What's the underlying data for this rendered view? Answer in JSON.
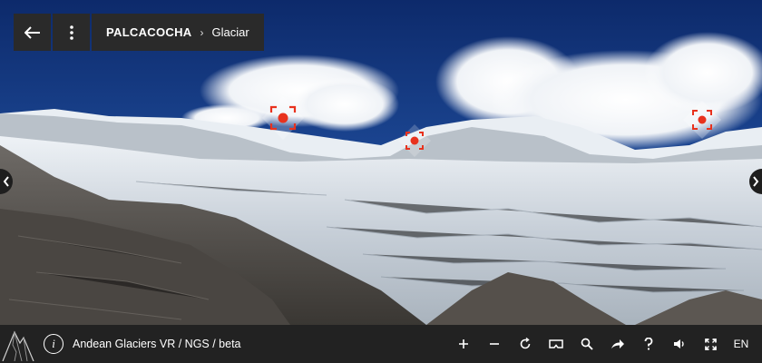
{
  "header": {
    "back_icon": "arrow-left-icon",
    "menu_icon": "vertical-dots-icon",
    "breadcrumb_root": "PALCACOCHA",
    "breadcrumb_separator": "›",
    "breadcrumb_current": "Glaciar"
  },
  "hotspots": [
    {
      "icon": "focus-target-icon"
    },
    {
      "icon": "focus-target-icon"
    },
    {
      "icon": "focus-target-icon"
    }
  ],
  "footer": {
    "app_title": "Andean Glaciers VR / NGS / beta",
    "info_label": "i",
    "language": "EN",
    "controls": [
      "zoom-in-icon",
      "zoom-out-icon",
      "rotate-icon",
      "vr-headset-icon",
      "search-icon",
      "share-icon",
      "help-icon",
      "volume-icon",
      "fullscreen-icon"
    ]
  },
  "colors": {
    "hotspot": "#e8321e",
    "bar_background": "#222222",
    "button_background": "#2a2a2a"
  }
}
